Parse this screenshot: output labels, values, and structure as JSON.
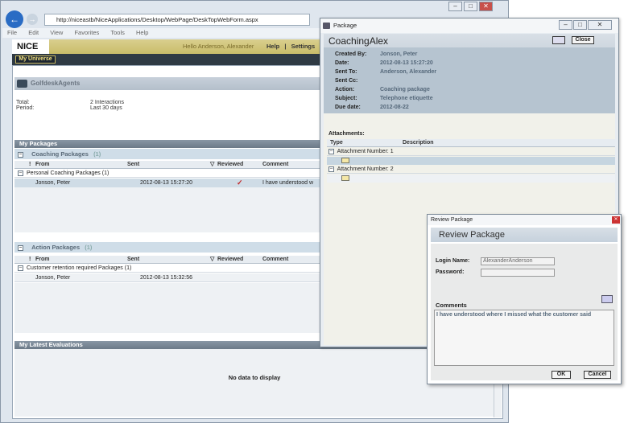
{
  "browser": {
    "address": "http://niceastb/NiceApplications/Desktop/WebPage/DeskTopWebForm.aspx",
    "menu": [
      "File",
      "Edit",
      "View",
      "Favorites",
      "Tools",
      "Help"
    ]
  },
  "nice": {
    "logo": "NICE",
    "hello": "Hello Anderson, Alexander",
    "help": "Help",
    "settings": "Settings",
    "tab": "My Universe"
  },
  "agent": {
    "name": "GolfdeskAgents",
    "total_label": "Total:",
    "total_value": "2 Interactions",
    "period_label": "Period:",
    "period_value": "Last 30 days"
  },
  "packages": {
    "section": "My Packages",
    "coaching": {
      "title": "Coaching Packages",
      "count": "(1)",
      "group": "Personal Coaching Packages (1)",
      "row": {
        "from": "Jonson, Peter",
        "sent": "2012-08-13 15:27:20",
        "reviewed": "✓",
        "comment": "I have understood w"
      }
    },
    "action": {
      "title": "Action Packages",
      "count": "(1)",
      "group": "Customer retention required Packages (1)",
      "row": {
        "from": "Jonson, Peter",
        "sent": "2012-08-13 15:32:56",
        "reviewed": "",
        "comment": ""
      }
    },
    "columns": {
      "flag": "!",
      "from": "From",
      "sent": "Sent",
      "reviewed": "Reviewed",
      "comment": "Comment"
    }
  },
  "evaluations": {
    "title": "My Latest Evaluations",
    "empty": "No data to display"
  },
  "package_window": {
    "titlebar": "Package",
    "title": "CoachingAlex",
    "close": "Close",
    "meta": [
      {
        "label": "Created By:",
        "value": "Jonson, Peter"
      },
      {
        "label": "Date:",
        "value": "2012-08-13 15:27:20"
      },
      {
        "label": "Sent To:",
        "value": "Anderson, Alexander"
      },
      {
        "label": "Sent Cc:",
        "value": ""
      },
      {
        "label": "Action:",
        "value": "Coaching package"
      },
      {
        "label": "Subject:",
        "value": "Telephone etiquette"
      },
      {
        "label": "Due date:",
        "value": "2012-08-22"
      }
    ],
    "attachments_label": "Attachments:",
    "att_columns": {
      "type": "Type",
      "description": "Description"
    },
    "att_groups": [
      "Attachment Number: 1",
      "Attachment Number: 2"
    ]
  },
  "review": {
    "titlebar": "Review Package",
    "title": "Review Package",
    "login_label": "Login Name:",
    "login_value": "AlexanderAnderson",
    "password_label": "Password:",
    "password_value": "",
    "comments_label": "Comments",
    "comment_text": "I have understood where I missed what the customer said",
    "ok": "OK",
    "cancel": "Cancel"
  }
}
